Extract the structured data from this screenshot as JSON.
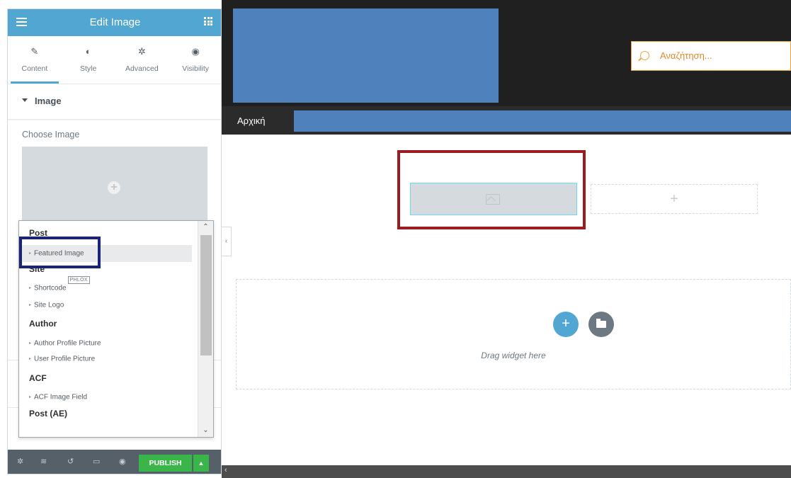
{
  "panel": {
    "title": "Edit Image",
    "tabs": [
      {
        "label": "Content",
        "icon": "pencil-icon"
      },
      {
        "label": "Style",
        "icon": "contrast-icon"
      },
      {
        "label": "Advanced",
        "icon": "gear-icon"
      },
      {
        "label": "Visibility",
        "icon": "eye-icon"
      }
    ],
    "section_title": "Image",
    "choose_image_label": "Choose Image",
    "dropdown": {
      "groups": [
        {
          "label": "Post",
          "items": [
            {
              "label": "Featured Image",
              "selected": true
            }
          ]
        },
        {
          "label": "Site",
          "items": [
            {
              "label": "Shortcode",
              "badge": "PHLOX"
            },
            {
              "label": "Site Logo"
            }
          ]
        },
        {
          "label": "Author",
          "items": [
            {
              "label": "Author Profile Picture"
            },
            {
              "label": "User Profile Picture"
            }
          ]
        },
        {
          "label": "ACF",
          "items": [
            {
              "label": "ACF Image Field"
            }
          ]
        },
        {
          "label": "Post (AE)",
          "items": []
        }
      ]
    },
    "footer": {
      "publish_label": "PUBLISH"
    }
  },
  "preview": {
    "search_placeholder": "Αναζήτηση...",
    "nav_home": "Αρχική",
    "drag_text": "Drag widget here",
    "empty_column_plus": "+",
    "add_plus": "+"
  },
  "colors": {
    "accent": "#52a7d2",
    "publish": "#39b54a",
    "logo_block": "#4f81bd",
    "highlight_red": "#9b1b1f",
    "highlight_navy": "#1b2477",
    "search_orange": "#f0a040"
  }
}
